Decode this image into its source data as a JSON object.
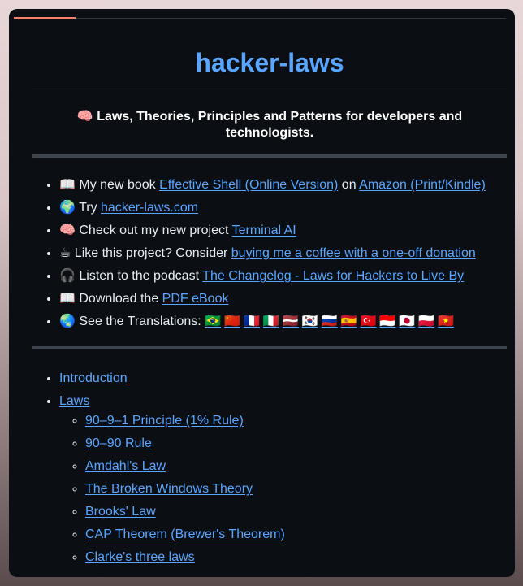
{
  "header": {
    "title": "hacker-laws",
    "tagline": "🧠 Laws, Theories, Principles and Patterns for developers and technologists."
  },
  "links": [
    {
      "icon": "book-icon",
      "parts": [
        {
          "text": "📖 My new book ",
          "link": false
        },
        {
          "text": "Effective Shell (Online Version)",
          "link": true
        },
        {
          "text": " on ",
          "link": false
        },
        {
          "text": "Amazon (Print/Kindle)",
          "link": true
        }
      ]
    },
    {
      "icon": "globe-icon",
      "parts": [
        {
          "text": "🌍 Try ",
          "link": false
        },
        {
          "text": "hacker-laws.com",
          "link": true
        }
      ]
    },
    {
      "icon": "brain-icon",
      "parts": [
        {
          "text": "🧠 Check out my new project ",
          "link": false
        },
        {
          "text": "Terminal AI",
          "link": true
        }
      ]
    },
    {
      "icon": "coffee-icon",
      "parts": [
        {
          "text": "☕ Like this project? Consider ",
          "link": false
        },
        {
          "text": "buying me a coffee with a one-off donation",
          "link": true
        }
      ]
    },
    {
      "icon": "headphones-icon",
      "parts": [
        {
          "text": "🎧 Listen to the podcast ",
          "link": false
        },
        {
          "text": "The Changelog - Laws for Hackers to Live By",
          "link": true
        }
      ]
    },
    {
      "icon": "book-icon",
      "parts": [
        {
          "text": "📖 Download the ",
          "link": false
        },
        {
          "text": "PDF eBook",
          "link": true
        }
      ]
    },
    {
      "icon": "globe-asia-icon",
      "parts": [
        {
          "text": "🌏 See the Translations: ",
          "link": false
        }
      ]
    }
  ],
  "translations": [
    "🇧🇷",
    "🇨🇳",
    "🇫🇷",
    "🇮🇹",
    "🇱🇻",
    "🇰🇷",
    "🇷🇺",
    "🇪🇸",
    "🇹🇷",
    "🇮🇩",
    "🇯🇵",
    "🇵🇱",
    "🇻🇳"
  ],
  "toc": {
    "introduction": "Introduction",
    "laws": "Laws",
    "law_items": [
      "90–9–1 Principle (1% Rule)",
      "90–90 Rule",
      "Amdahl's Law",
      "The Broken Windows Theory",
      "Brooks' Law",
      "CAP Theorem (Brewer's Theorem)",
      "Clarke's three laws"
    ]
  },
  "colors": {
    "background": "#0b0f14",
    "link": "#58a6ff",
    "text": "#e6edf3",
    "accent": "#f78166"
  }
}
